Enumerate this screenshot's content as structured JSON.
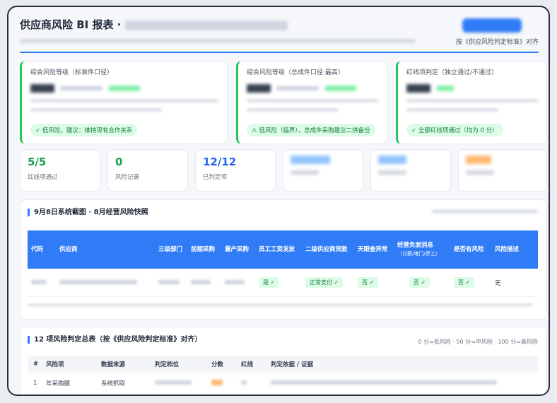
{
  "header": {
    "title": "供应商风险 BI 报表 ·",
    "align_note": "按《供应风险判定标准》对齐"
  },
  "verdicts": [
    {
      "title": "综合风险等级（标准件口径）",
      "badge": "✓ 低风险，建议：维持现有合作关系"
    },
    {
      "title": "综合风险等级（总成件口径·最高）",
      "badge": "⚠ 低风险（临界），总成件采购建议二供备份"
    },
    {
      "title": "红线项判定（独立通过/不通过）",
      "badge": "✓ 全部红线项通过（均为 0 分）"
    }
  ],
  "metrics": [
    {
      "value": "5/5",
      "label": "红线项通过"
    },
    {
      "value": "0",
      "label": "风险记录"
    },
    {
      "value": "12/12",
      "label": "已判定项"
    }
  ],
  "snapshot": {
    "title": "9月8日系统截图 · 8月经营风险快照",
    "columns": [
      {
        "label": "代码"
      },
      {
        "label": "供应商"
      },
      {
        "label": "三级部门"
      },
      {
        "label": "前期采购"
      },
      {
        "label": "量产采购"
      },
      {
        "label": "员工工资发放"
      },
      {
        "label": "二级供应商货款"
      },
      {
        "label": "天眼查异常"
      },
      {
        "label": "经营负面消息",
        "sub": "（讨薪/堵门/停工）"
      },
      {
        "label": "是否有风险"
      },
      {
        "label": "风险描述"
      }
    ],
    "row": {
      "wage": "是 ✓",
      "supplier_payment": "正常支付 ✓",
      "tianyancha": "否 ✓",
      "negative_news": "否 ✓",
      "has_risk": "否 ✓",
      "risk_desc": "无"
    }
  },
  "summary": {
    "title": "12 项风险判定总表（按《供应风险判定标准》对齐）",
    "legend": "0 分=低风险 · 50 分=中风险 · 100 分=高风险",
    "columns": [
      "#",
      "风险项",
      "数据来源",
      "判定档位",
      "分数",
      "红线",
      "判定依据 / 证据"
    ],
    "rows": [
      {
        "n": "1",
        "item": "年采购额",
        "source": "系统抓取"
      }
    ]
  },
  "colors": {
    "accent": "#2f7cf6",
    "ok": "#16a34a",
    "ok_bg": "#dcfce7"
  }
}
